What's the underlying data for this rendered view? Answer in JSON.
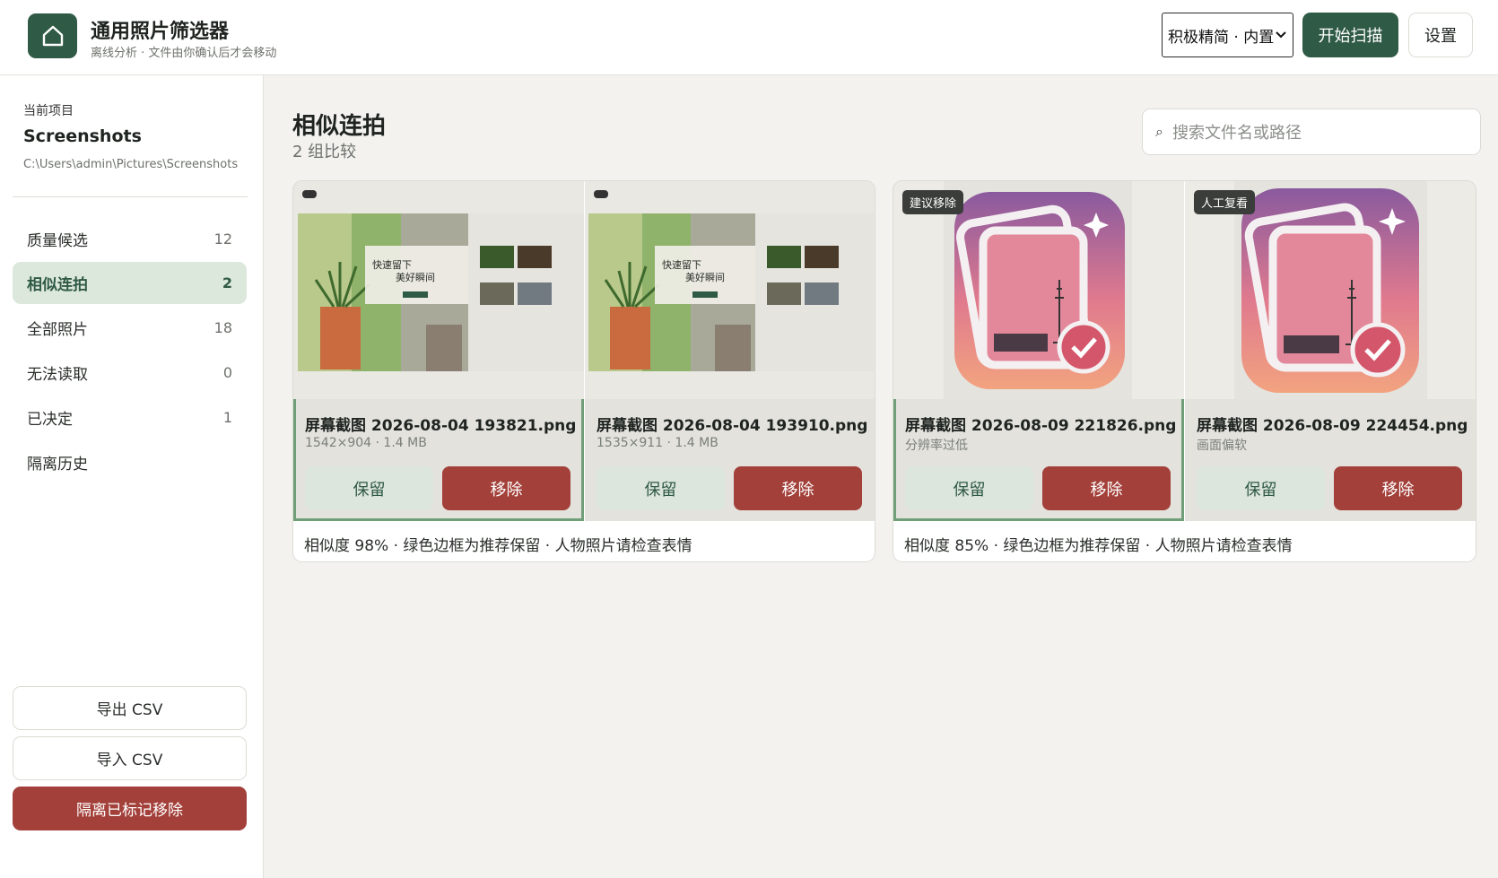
{
  "header": {
    "title": "通用照片筛选器",
    "subtitle": "离线分析 · 文件由你确认后才会移动",
    "mode": "积极精简 · 内置",
    "scan_label": "开始扫描",
    "settings_label": "设置"
  },
  "sidebar": {
    "project_label": "当前项目",
    "project_name": "Screenshots",
    "project_path": "C:\\Users\\admin\\Pictures\\Screenshots",
    "items": [
      {
        "label": "质量候选",
        "count": "12"
      },
      {
        "label": "相似连拍",
        "count": "2"
      },
      {
        "label": "全部照片",
        "count": "18"
      },
      {
        "label": "无法读取",
        "count": "0"
      },
      {
        "label": "已决定",
        "count": "1"
      },
      {
        "label": "隔离历史",
        "count": ""
      }
    ],
    "export_csv": "导出 CSV",
    "import_csv": "导入 CSV",
    "quarantine_label": "隔离已标记移除"
  },
  "main": {
    "title": "相似连拍",
    "subtitle": "2 组比较",
    "search_placeholder": "搜索文件名或路径",
    "groups": [
      {
        "note": "相似度 98% · 绿色边框为推荐保留 · 人物照片请检查表情",
        "photos": [
          {
            "filename": "屏幕截图 2026-08-04 193821.png",
            "meta": "1542×904 · 1.4 MB",
            "badge": "",
            "keep": "保留",
            "remove": "移除",
            "recommended": true
          },
          {
            "filename": "屏幕截图 2026-08-04 193910.png",
            "meta": "1535×911 · 1.4 MB",
            "badge": "",
            "keep": "保留",
            "remove": "移除",
            "recommended": false
          }
        ]
      },
      {
        "note": "相似度 85% · 绿色边框为推荐保留 · 人物照片请检查表情",
        "photos": [
          {
            "filename": "屏幕截图 2026-08-09 221826.png",
            "meta": "分辨率过低",
            "badge": "建议移除",
            "keep": "保留",
            "remove": "移除",
            "recommended": true
          },
          {
            "filename": "屏幕截图 2026-08-09 224454.png",
            "meta": "画面偏软",
            "badge": "人工复看",
            "keep": "保留",
            "remove": "移除",
            "recommended": false
          }
        ]
      }
    ]
  },
  "thumb_text": {
    "headline_1": "快速留下",
    "headline_2": "美好瞬间"
  },
  "colors": {
    "accent": "#2f5a45",
    "danger": "#a3403a",
    "active_bg": "#dde8dd",
    "recommended_border": "#6f9e78"
  }
}
